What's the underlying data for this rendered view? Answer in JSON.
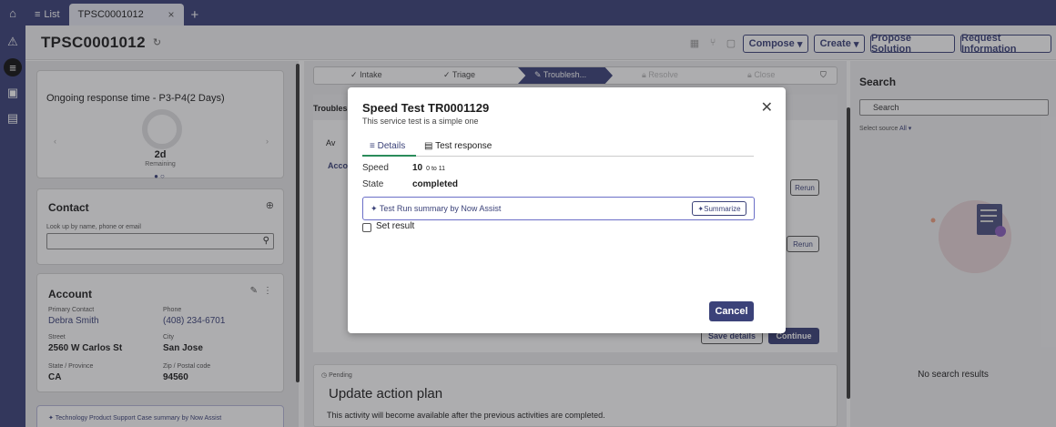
{
  "tabs": {
    "list_label": "List",
    "record_label": "TPSC0001012",
    "close_glyph": "×",
    "new_glyph": "+"
  },
  "header": {
    "title": "TPSC0001012",
    "compose_label": "Compose",
    "create_label": "Create",
    "propose_label": "Propose Solution",
    "request_label": "Request Information"
  },
  "response": {
    "title": "Ongoing response time - P3-P4(2 Days)",
    "value": "2d",
    "caption": "Remaining"
  },
  "contact": {
    "title": "Contact",
    "lookup_label": "Look up by name, phone or email"
  },
  "account": {
    "title": "Account",
    "primary_contact_label": "Primary Contact",
    "primary_contact": "Debra Smith",
    "phone_label": "Phone",
    "phone": "(408) 234-6701",
    "street_label": "Street",
    "street": "2560 W Carlos St",
    "city_label": "City",
    "city": "San Jose",
    "state_label": "State / Province",
    "state": "CA",
    "zip_label": "Zip / Postal code",
    "zip": "94560"
  },
  "case_summary": {
    "label": "Technology Product Support Case summary by Now Assist"
  },
  "stages": [
    {
      "label": "Intake"
    },
    {
      "label": "Triage"
    },
    {
      "label": "Troublesh..."
    },
    {
      "label": "Resolve"
    },
    {
      "label": "Close"
    }
  ],
  "midpanel": {
    "head_label": "Troubles",
    "tab_label": "Av",
    "section_label": "Acco",
    "rerun_label": "Rerun",
    "details_label": "details",
    "save_label": "Save details",
    "continue_label": "Continue"
  },
  "pending": {
    "status": "Pending",
    "title": "Update action plan",
    "message": "This activity will become available after the previous activities are completed."
  },
  "search": {
    "title": "Search",
    "placeholder": "Search",
    "source_label": "Select source",
    "source_value": "All",
    "empty": "No search results"
  },
  "modal": {
    "title": "Speed Test TR0001129",
    "subtitle": "This service test is a simple one",
    "tab_details": "Details",
    "tab_response": "Test response",
    "speed_label": "Speed",
    "speed_value": "10",
    "speed_range": "0 to 11",
    "state_label": "State",
    "state_value": "completed",
    "assist_label": "Test Run summary by Now Assist",
    "summarize_label": "Summarize",
    "set_result_label": "Set result",
    "cancel_label": "Cancel"
  },
  "colors": {
    "accent": "#3b4279",
    "tab_underline": "#2a8c5a"
  },
  "icons": [
    "home-icon",
    "alert-icon",
    "list-icon",
    "inbox-icon",
    "calendar-icon",
    "refresh-icon",
    "close-icon",
    "search-icon",
    "sparkle-icon",
    "add-icon",
    "edit-icon",
    "more-icon",
    "chevron-left-icon",
    "chevron-right-icon",
    "filter-icon",
    "check-icon",
    "lock-icon"
  ]
}
